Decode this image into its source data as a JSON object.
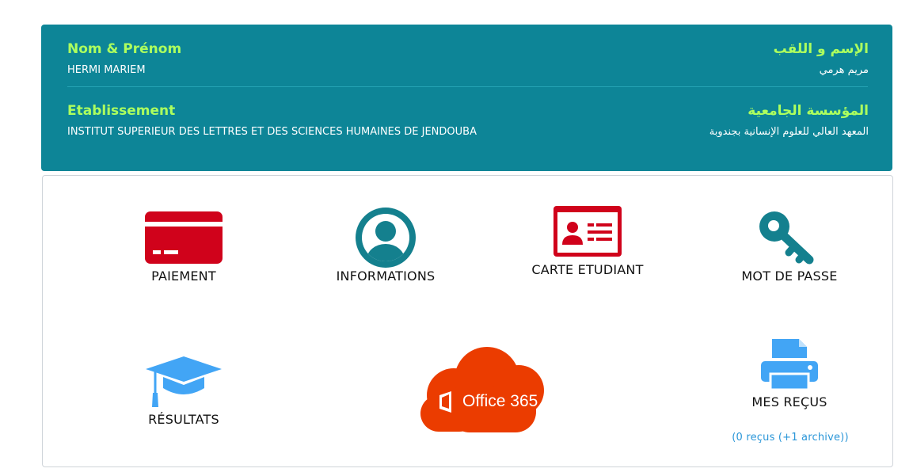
{
  "profile": {
    "name_label_fr": "Nom & Prénom",
    "name_value_fr": "HERMI MARIEM",
    "name_label_ar": "الإسم و اللقب",
    "name_value_ar": "مريم هرمي",
    "inst_label_fr": "Etablissement",
    "inst_value_fr": "INSTITUT SUPERIEUR DES LETTRES ET DES SCIENCES HUMAINES DE JENDOUBA",
    "inst_label_ar": "المؤسسة الجامعية",
    "inst_value_ar": "المعهد العالي للعلوم الإنسانية بجندوبة"
  },
  "tiles": {
    "paiement": "PAIEMENT",
    "informations": "INFORMATIONS",
    "carte": "CARTE ETUDIANT",
    "mot_de_passe": "MOT DE PASSE",
    "resultats": "RÉSULTATS",
    "office": "Office 365",
    "recus": "MES REÇUS",
    "recus_sub": "(0 reçus (+1 archive))"
  },
  "colors": {
    "header_bg": "#0d8597",
    "label_green": "#adff5e",
    "red": "#d0021b",
    "teal_icon": "#14808e",
    "blue_icon": "#42a5f5",
    "office_orange": "#eb3c00",
    "link_blue": "#2a96d8"
  },
  "icons": {
    "paiement": "credit-card-icon",
    "informations": "user-circle-icon",
    "carte": "id-card-icon",
    "mot_de_passe": "key-icon",
    "resultats": "graduation-cap-icon",
    "office": "office365-cloud-icon",
    "recus": "printer-icon"
  }
}
